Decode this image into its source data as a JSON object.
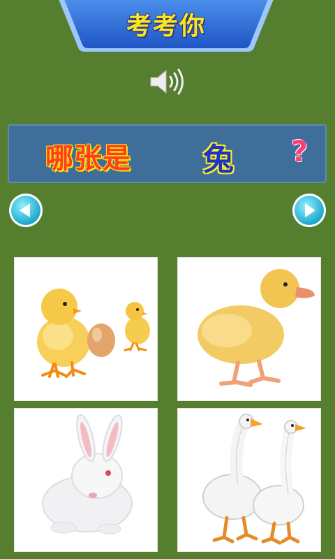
{
  "header": {
    "title": "考考你"
  },
  "audio": {
    "icon": "speaker-icon"
  },
  "question": {
    "prefix": "哪张是",
    "word": "兔",
    "mark": "?"
  },
  "navigation": {
    "prev_icon": "arrow-left-icon",
    "next_icon": "arrow-right-icon"
  },
  "answers": [
    {
      "icon": "chick-image"
    },
    {
      "icon": "duckling-image"
    },
    {
      "icon": "rabbit-image"
    },
    {
      "icon": "goose-image"
    }
  ],
  "colors": {
    "background": "#567e2f",
    "banner": "#2f6fd8",
    "title_text": "#ffe61a",
    "question_bar": "#3f6e9a",
    "nav_button": "#19b6d8"
  }
}
